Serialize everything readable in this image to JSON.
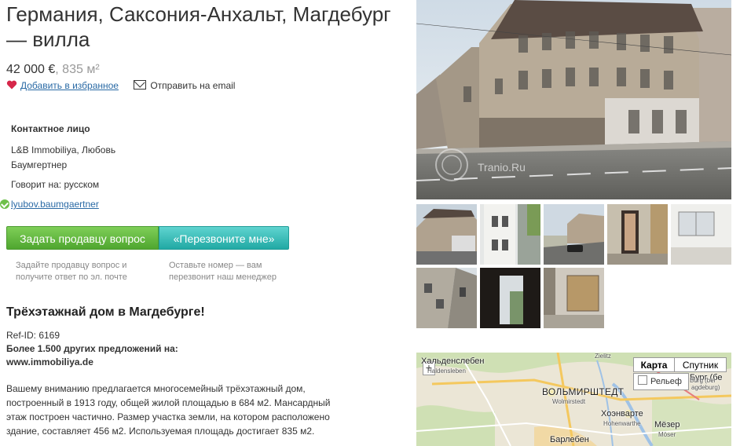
{
  "listing": {
    "title": "Германия, Саксония-Анхальт, Магдебург — вилла",
    "price": "42 000 €",
    "area": ", 835 м²",
    "favorite_label": "Добавить в избранное",
    "email_label": "Отправить на email"
  },
  "contact": {
    "label": "Контактное лицо",
    "name": "L&B Immobiliya, Любовь Баумгертнер",
    "language": "Говорит на: русском",
    "email": "lyubov.baumgaertner"
  },
  "actions": {
    "ask_button": "Задать продавцу вопрос",
    "call_button": "«Перезвоните мне»",
    "ask_hint": "Задайте продавцу вопрос и получите ответ по эл. почте",
    "call_hint": "Оставьте номер — вам перезвонит наш менеджер"
  },
  "description": {
    "headline": "Трёхэтажнай дом в Магдебурге!",
    "ref_id": "Ref-ID: 6169",
    "offers_line": "Более 1.500 других предложений на:",
    "site": "www.immobiliya.de",
    "text": "Вашему вниманию предлагается многосемейный трёхэтажный дом, построенный в 1913 году, общей жилой площадью в 684 м2. Мансардный этаж построен частично. Размер участка земли, на котором расположено здание, составляет 456 м2. Используемая площадь достигает 835 м2."
  },
  "gallery": {
    "watermark": "Tranio.Ru",
    "thumb_count": 8
  },
  "map": {
    "tab_map": "Карта",
    "tab_satellite": "Спутник",
    "relief": "Рельеф",
    "zoom_in": "+",
    "labels": {
      "haldensleben_ru": "Хальденслебен",
      "haldensleben_de": "Haldensleben",
      "zielitz": "Zielitz",
      "wolmirstedt_ru": "ВОЛЬМИРШТЕДТ",
      "wolmirstedt_de": "Wolmirstedt",
      "hohenwarthe_ru": "Хоэнварте",
      "hohenwarthe_de": "Hohenwarthe",
      "burg_ru": "Бург (бе",
      "burg_de": "Burg (bei",
      "magdeburg_de": "agdeburg)",
      "moeser_ru": "Мёзер",
      "moeser_de": "Möser",
      "barleben_ru": "Барлебен"
    }
  },
  "colors": {
    "ask_green": "#5cb338",
    "call_teal": "#2bb3ae",
    "link_blue": "#2a6aa5",
    "heart_red": "#d6274a"
  }
}
